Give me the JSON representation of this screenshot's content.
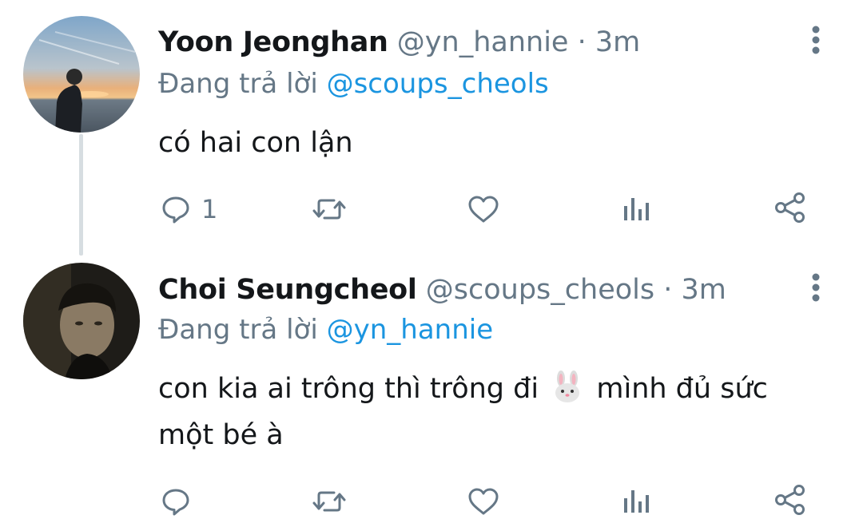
{
  "tweets": [
    {
      "display_name": "Yoon Jeonghan",
      "handle": "@yn_hannie",
      "separator": "·",
      "time": "3m",
      "reply_prefix": "Đang trả lời",
      "reply_to": "@scoups_cheols",
      "text": "có hai con lận",
      "reply_count": "1"
    },
    {
      "display_name": "Choi Seungcheol",
      "handle": "@scoups_cheols",
      "separator": "·",
      "time": "3m",
      "reply_prefix": "Đang trả lời",
      "reply_to": "@yn_hannie",
      "text_part1": "con kia ai trông thì trông đi",
      "text_emoji": "rabbit-face-icon",
      "text_part2": "mình đủ sức",
      "text_line2": "một bé à",
      "reply_count": ""
    }
  ],
  "colors": {
    "text": "#14171a",
    "secondary": "#657786",
    "link": "#1b95e0",
    "thread_line": "#d7dde1"
  },
  "icons": [
    "reply-icon",
    "retweet-icon",
    "like-icon",
    "analytics-icon",
    "share-icon",
    "more-options-icon"
  ]
}
